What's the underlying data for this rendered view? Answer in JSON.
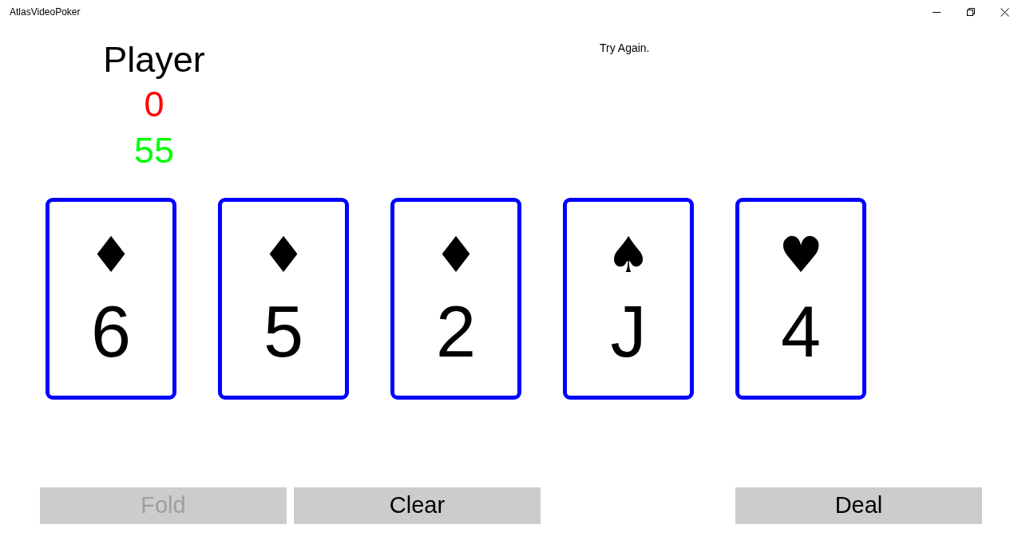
{
  "window": {
    "title": "AtlasVideoPoker"
  },
  "player": {
    "name": "Player",
    "values": [
      {
        "text": "0",
        "color": "#ff0000"
      },
      {
        "text": "55",
        "color": "#00ff00"
      }
    ]
  },
  "message": "Try Again.",
  "cards": [
    {
      "suit": "♦",
      "rank": "6"
    },
    {
      "suit": "♦",
      "rank": "5"
    },
    {
      "suit": "♦",
      "rank": "2"
    },
    {
      "suit": "♠",
      "rank": "J"
    },
    {
      "suit": "♥",
      "rank": "4"
    }
  ],
  "buttons": [
    {
      "label": "Fold",
      "disabled": true
    },
    {
      "label": "Clear",
      "disabled": false
    },
    {
      "label": "Deal",
      "disabled": false
    }
  ]
}
